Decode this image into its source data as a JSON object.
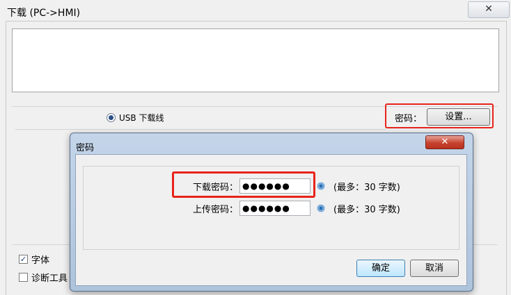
{
  "main_window": {
    "title": "下载 (PC->HMI)",
    "close_symbol": "✕",
    "connection_option": "USB 下载线",
    "password_label": "密码：",
    "settings_button": "设置...",
    "checkboxes": [
      {
        "label": "字体",
        "checked": true
      },
      {
        "label": "诊断工具",
        "checked": false
      }
    ]
  },
  "password_dialog": {
    "title": "密码",
    "close_symbol": "✕",
    "download_password": {
      "label": "下载密码：",
      "value": "●●●●●●",
      "hint": "(最多：30 字数)"
    },
    "upload_password": {
      "label": "上传密码：",
      "value": "●●●●●●",
      "hint": "(最多：30 字数)"
    },
    "ok_button": "确定",
    "cancel_button": "取消"
  },
  "colors": {
    "highlight": "#e8231a",
    "dialog_frame": "#b9cde4"
  }
}
